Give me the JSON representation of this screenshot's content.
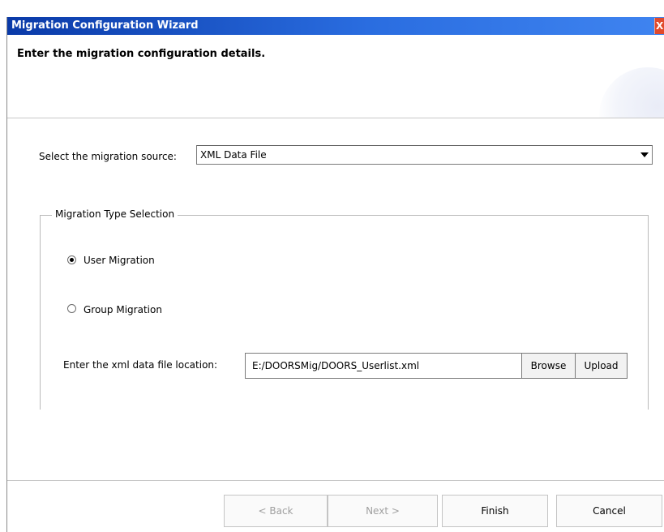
{
  "window": {
    "title": "Migration Configuration Wizard",
    "close_glyph": "X"
  },
  "header": {
    "title": "Enter the migration configuration details."
  },
  "source": {
    "label": "Select the migration source:",
    "selected": "XML Data File"
  },
  "migration_type": {
    "legend": "Migration Type Selection",
    "options": [
      {
        "label": "User Migration",
        "checked": true
      },
      {
        "label": "Group Migration",
        "checked": false
      }
    ]
  },
  "file": {
    "label": "Enter the xml data file location:",
    "value": "E:/DOORSMig/DOORS_Userlist.xml",
    "browse_label": "Browse",
    "upload_label": "Upload"
  },
  "footer": {
    "back_label": "< Back",
    "next_label": "Next >",
    "finish_label": "Finish",
    "cancel_label": "Cancel"
  },
  "colors": {
    "titlebar": "#2a6de0",
    "close": "#e14a2c",
    "disabled_text": "#a0a0a0"
  }
}
